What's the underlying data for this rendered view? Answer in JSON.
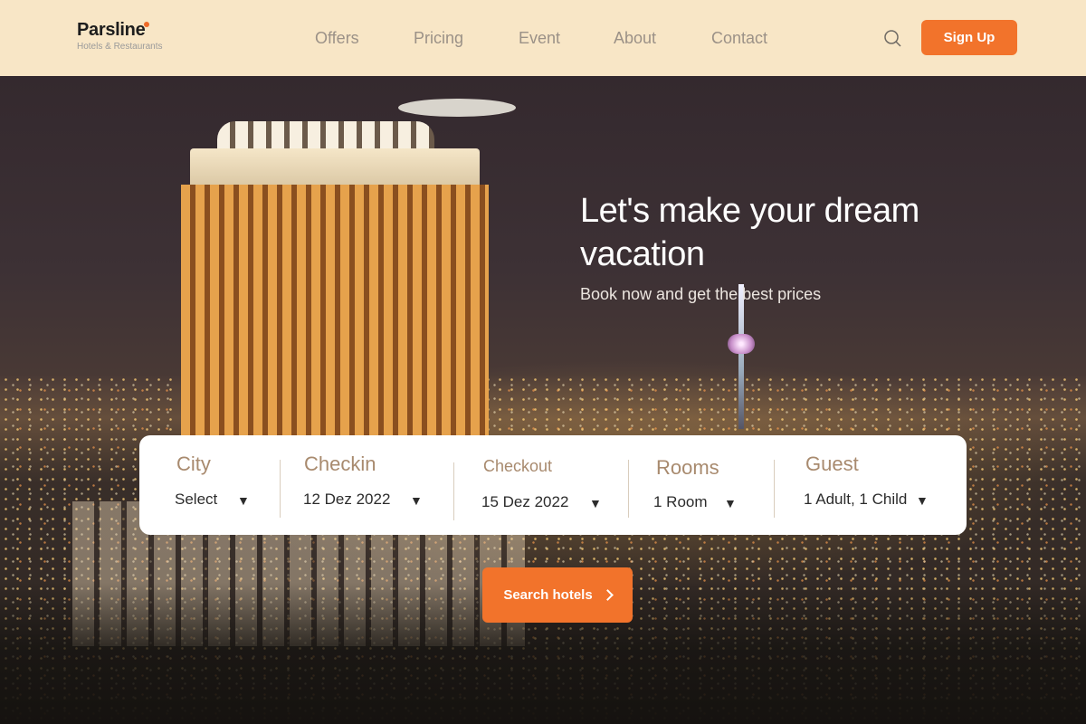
{
  "header": {
    "brand": "Parsline",
    "brand_sub": "Hotels & Restaurants",
    "nav": [
      "Offers",
      "Pricing",
      "Event",
      "About",
      "Contact"
    ],
    "signup_label": "Sign Up"
  },
  "hero": {
    "headline": "Let's make your dream vacation",
    "subline": "Book now and get the best prices"
  },
  "booking": {
    "fields": [
      {
        "label": "City",
        "value": "Select"
      },
      {
        "label": "Checkin",
        "value": "12 Dez 2022"
      },
      {
        "label": "Checkout",
        "value": "15 Dez 2022"
      },
      {
        "label": "Rooms",
        "value": "1 Room"
      },
      {
        "label": "Guest",
        "value": "1 Adult, 1 Child"
      }
    ],
    "search_label": "Search hotels"
  },
  "colors": {
    "header_bg": "#f8e6c6",
    "accent": "#f2732b",
    "label": "#a88a6e"
  },
  "icons": {
    "search": "search-icon",
    "caret": "caret-down-icon",
    "arrow": "chevron-right-icon"
  }
}
